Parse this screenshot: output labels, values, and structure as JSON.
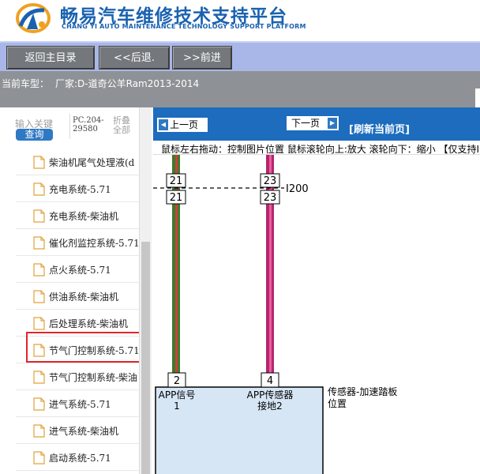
{
  "header": {
    "title": "畅易汽车维修技术支持平台",
    "subtitle": "CHANG YI AUTO MAINTENANCE TECHNOLOGY SUPPORT PLATFORM"
  },
  "nav": {
    "home_label": "返回主目录",
    "back_label": "<<后退.",
    "forward_label": ">>前进"
  },
  "vehicle": {
    "label": "当前车型：",
    "model": "厂家:D-道奇公羊Ram2013-2014"
  },
  "search": {
    "label": "输入关键",
    "button_label": "查询",
    "pc_line1": "PC.204-",
    "pc_line2": "29580",
    "collapse_line1": "折叠",
    "collapse_line2": "全部"
  },
  "tree": {
    "items": [
      "柴油机尾气处理液(d",
      "充电系统-5.71",
      "充电系统-柴油机",
      "催化剂监控系统-5.71",
      "点火系统-5.71",
      "供油系统-柴油机",
      "后处理系统-柴油机",
      "节气门控制系统-5.71",
      "节气门控制系统-柴油",
      "进气系统-5.71",
      "进气系统-柴油机",
      "启动系统-5.71"
    ],
    "selected_index": 7
  },
  "viewer": {
    "prev_label": "上一页",
    "next_label": "下一页",
    "refresh_label": "[刷新当前页]",
    "hint": "鼠标左右拖动：控制图片位置  鼠标滚轮向上:放大   滚轮向下：缩小  【仅支持IE浏览器】"
  },
  "diagram": {
    "connector_top_label": "I200",
    "left_wire_pin_top": "21",
    "left_wire_pin_bottom": "21",
    "right_wire_pin_top": "23",
    "right_wire_pin_bottom": "23",
    "left_pin": "2",
    "right_pin": "4",
    "left_box_line1": "APP信号",
    "left_box_line2": "1",
    "right_box_line1": "APP传感器",
    "right_box_line2": "接地2",
    "component_line1": "传感器-加速踏板",
    "component_line2": "位置",
    "colors": {
      "left_wire": [
        "#3a7d2c",
        "#d23c3c"
      ],
      "right_wire": [
        "#b3266e",
        "#e8609e"
      ],
      "module_fill": "#d6e6f4"
    }
  }
}
